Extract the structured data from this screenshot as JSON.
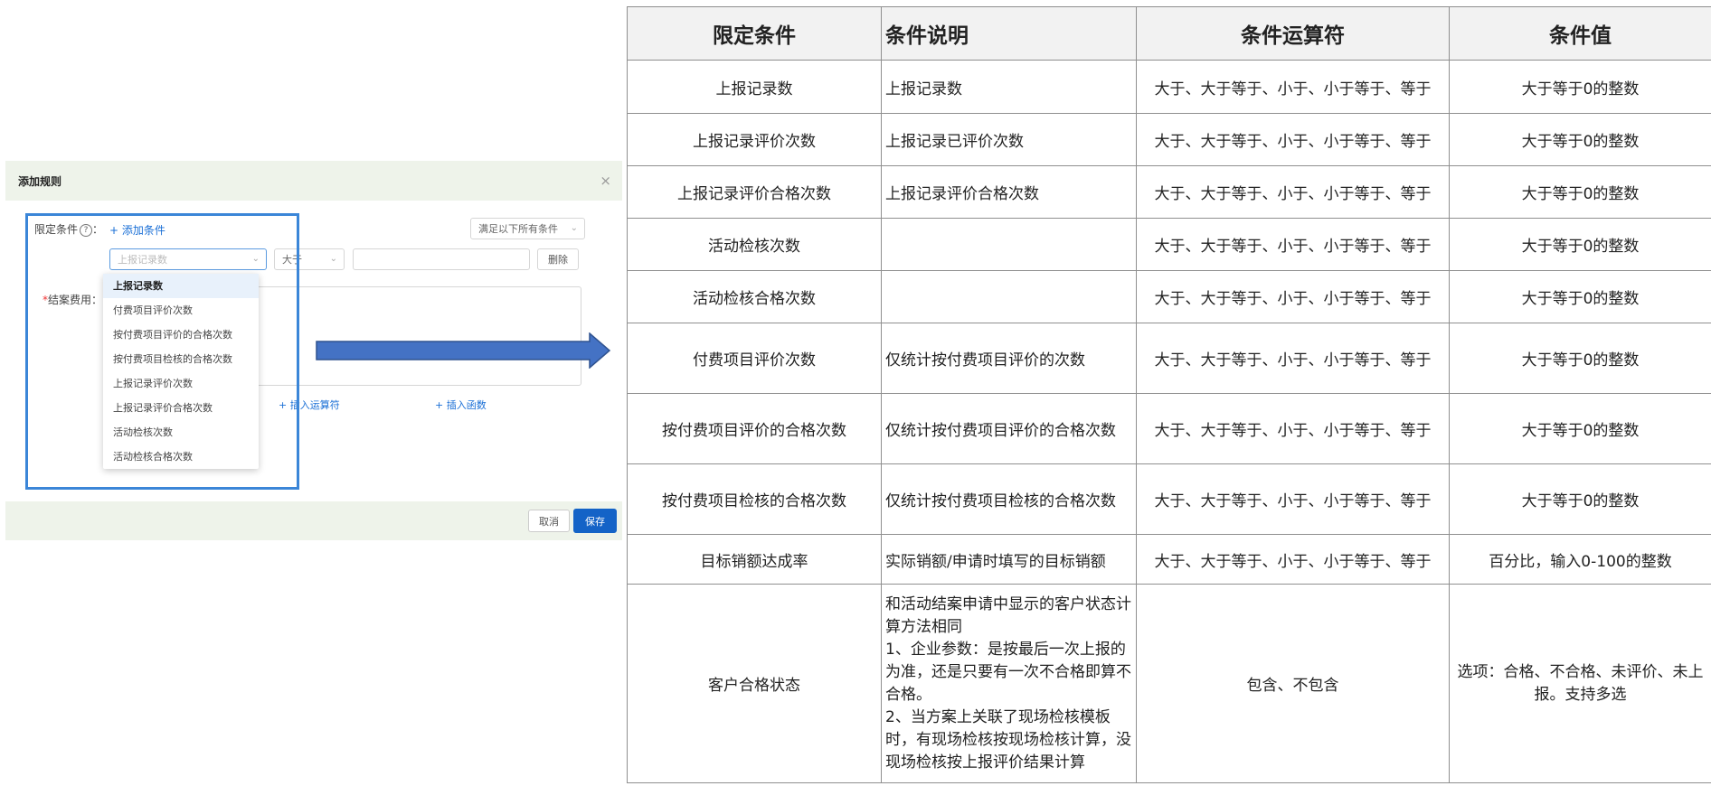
{
  "dialog": {
    "title": "添加规则",
    "close_glyph": "×",
    "condition_label": "限定条件",
    "help_glyph": "?",
    "colon": "：",
    "add_condition": "+ 添加条件",
    "match_mode": "满足以下所有条件",
    "condition_field_placeholder": "上报记录数",
    "operator_value": "大于",
    "delete_label": "删除",
    "fee_label": "结案费用：",
    "required_mark": "*",
    "insert_operator": "+ 插入运算符",
    "insert_function": "+ 插入函数",
    "dropdown_options": [
      "上报记录数",
      "付费项目评价次数",
      "按付费项目评价的合格次数",
      "按付费项目检核的合格次数",
      "上报记录评价次数",
      "上报记录评价合格次数",
      "活动检核次数",
      "活动检核合格次数"
    ],
    "cancel_label": "取消",
    "save_label": "保存"
  },
  "table": {
    "headers": [
      "限定条件",
      "条件说明",
      "条件运算符",
      "条件值"
    ],
    "rows": [
      {
        "condition": "上报记录数",
        "description": "上报记录数",
        "operators": "大于、大于等于、小于、小于等于、等于",
        "value": "大于等于0的整数"
      },
      {
        "condition": "上报记录评价次数",
        "description": "上报记录已评价次数",
        "operators": "大于、大于等于、小于、小于等于、等于",
        "value": "大于等于0的整数"
      },
      {
        "condition": "上报记录评价合格次数",
        "description": "上报记录评价合格次数",
        "operators": "大于、大于等于、小于、小于等于、等于",
        "value": "大于等于0的整数"
      },
      {
        "condition": "活动检核次数",
        "description": "",
        "operators": "大于、大于等于、小于、小于等于、等于",
        "value": "大于等于0的整数"
      },
      {
        "condition": "活动检核合格次数",
        "description": "",
        "operators": "大于、大于等于、小于、小于等于、等于",
        "value": "大于等于0的整数"
      },
      {
        "condition": "付费项目评价次数",
        "description": "仅统计按付费项目评价的次数",
        "operators": "大于、大于等于、小于、小于等于、等于",
        "value": "大于等于0的整数"
      },
      {
        "condition": "按付费项目评价的合格次数",
        "description": "仅统计按付费项目评价的合格次数",
        "operators": "大于、大于等于、小于、小于等于、等于",
        "value": "大于等于0的整数"
      },
      {
        "condition": "按付费项目检核的合格次数",
        "description": "仅统计按付费项目检核的合格次数",
        "operators": "大于、大于等于、小于、小于等于、等于",
        "value": "大于等于0的整数"
      },
      {
        "condition": "目标销额达成率",
        "description": "实际销额/申请时填写的目标销额",
        "operators": "大于、大于等于、小于、小于等于、等于",
        "value": "百分比，输入0-100的整数"
      },
      {
        "condition": "客户合格状态",
        "description_lines": [
          "和活动结案申请中显示的客户状态计",
          "算方法相同",
          "1、企业参数：是按最后一次上报的",
          "为准，还是只要有一次不合格即算不",
          "合格。",
          "2、当方案上关联了现场检核模板",
          "时，有现场检核按现场检核计算，没",
          "现场检核按上报评价结果计算"
        ],
        "operators": "包含、不包含",
        "value_lines": [
          "选项：合格、不合格、未评价、未上",
          "报。支持多选"
        ]
      }
    ]
  },
  "colors": {
    "highlight": "#3b86d8",
    "arrow_fill": "#4472c4",
    "arrow_stroke": "#2f528f",
    "primary_button": "#1463c7",
    "link": "#1a6fd6"
  }
}
